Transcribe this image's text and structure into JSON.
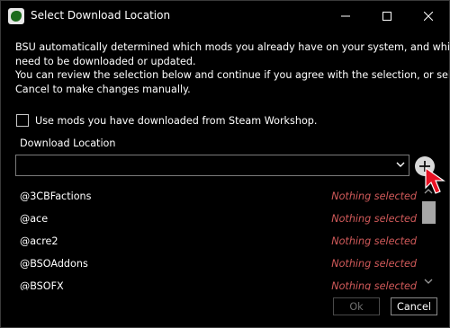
{
  "window": {
    "title": "Select Download Location",
    "icon": "app-logo-icon"
  },
  "description": {
    "lines": [
      "BSU automatically determined which mods you already have on your system, and which",
      "need to be downloaded or updated.",
      "You can review the selection below and continue if you agree with the selection, or select",
      "Cancel to make changes manually."
    ]
  },
  "workshop_option": {
    "label": "Use mods you have downloaded from Steam Workshop.",
    "checked": false
  },
  "download_location": {
    "label": "Download Location",
    "value": ""
  },
  "mods": [
    {
      "name": "@3CBFactions",
      "status": "Nothing selected"
    },
    {
      "name": "@ace",
      "status": "Nothing selected"
    },
    {
      "name": "@acre2",
      "status": "Nothing selected"
    },
    {
      "name": "@BSOAddons",
      "status": "Nothing selected"
    },
    {
      "name": "@BSOFX",
      "status": "Nothing selected"
    }
  ],
  "buttons": {
    "ok_label": "Ok",
    "cancel_label": "Cancel",
    "ok_enabled": false
  },
  "colors": {
    "background": "#000000",
    "status_text": "#d25a5a",
    "disabled_text": "#6f6f6f",
    "cursor": "#e81123"
  }
}
